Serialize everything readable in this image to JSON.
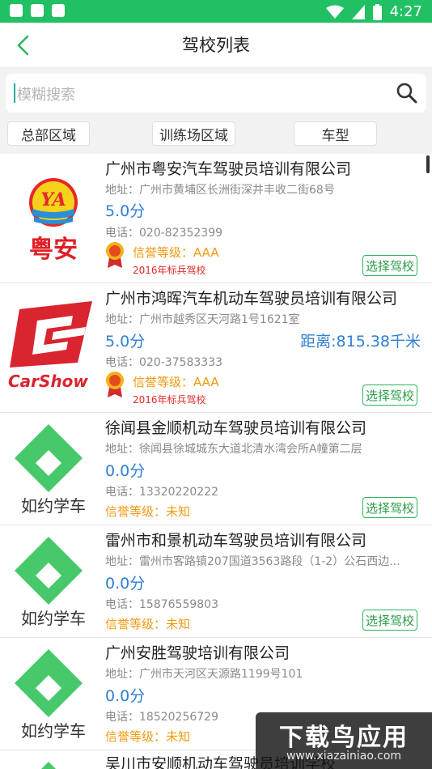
{
  "statusbar": {
    "time": "4:27"
  },
  "appbar": {
    "title": "驾校列表"
  },
  "search": {
    "placeholder": "模糊搜索"
  },
  "filters": [
    "总部区域",
    "训练场区域",
    "车型"
  ],
  "schools": [
    {
      "logo": "yuean",
      "logo_text": "粤安",
      "name": "广州市粤安汽车驾驶员培训有限公司",
      "address": "地址：广州市黄埔区长洲街深井丰收二街68号",
      "score": "5.0分",
      "distance": "",
      "phone": "电话：020-82352399",
      "credit": "信誉等级：AAA",
      "tag": "2016年标兵驾校",
      "action": "选择驾校"
    },
    {
      "logo": "carshow",
      "logo_text": "CarShow",
      "name": "广州市鸿晖汽车机动车驾驶员培训有限公司",
      "address": "地址：广州市越秀区天河路1号1621室",
      "score": "5.0分",
      "distance": "距离:815.38千米",
      "phone": "电话：020-37583333",
      "credit": "信誉等级：AAA",
      "tag": "2016年标兵驾校",
      "action": "选择驾校"
    },
    {
      "logo": "ruyue",
      "logo_text": "如约学车",
      "name": "徐闻县金顺机动车驾驶员培训有限公司",
      "address": "地址：徐闻县徐城城东大道北清水湾会所A幢第二层",
      "score": "0.0分",
      "distance": "",
      "phone": "电话：13320220222",
      "credit": "信誉等级：未知",
      "tag": "",
      "action": "选择驾校"
    },
    {
      "logo": "ruyue",
      "logo_text": "如约学车",
      "name": "雷州市和景机动车驾驶员培训有限公司",
      "address": "地址：雷州市客路镇207国道3563路段（1-2）公石西边...",
      "score": "0.0分",
      "distance": "",
      "phone": "电话：15876559803",
      "credit": "信誉等级：未知",
      "tag": "",
      "action": "选择驾校"
    },
    {
      "logo": "ruyue",
      "logo_text": "如约学车",
      "name": "广州安胜驾驶培训有限公司",
      "address": "地址：广州市天河区天源路1199号101",
      "score": "0.0分",
      "distance": "",
      "phone": "电话：18520256729",
      "credit": "信誉等级：未知",
      "tag": "",
      "action": ""
    },
    {
      "logo": "ruyue",
      "logo_text": "",
      "name": "吴川市安顺机动车驾驶员培训学校",
      "address": "",
      "score": "",
      "distance": "",
      "phone": "",
      "credit": "",
      "tag": "",
      "action": ""
    }
  ],
  "watermark": {
    "line1": "下载鸟应用",
    "line2": "www.xiazainiao.com"
  },
  "colors": {
    "statusbar": "#21c065",
    "accent_blue": "#2f7fd6",
    "credit_orange": "#f09a12",
    "tag_red": "#e52a2a",
    "select_green": "#2cb55a"
  }
}
